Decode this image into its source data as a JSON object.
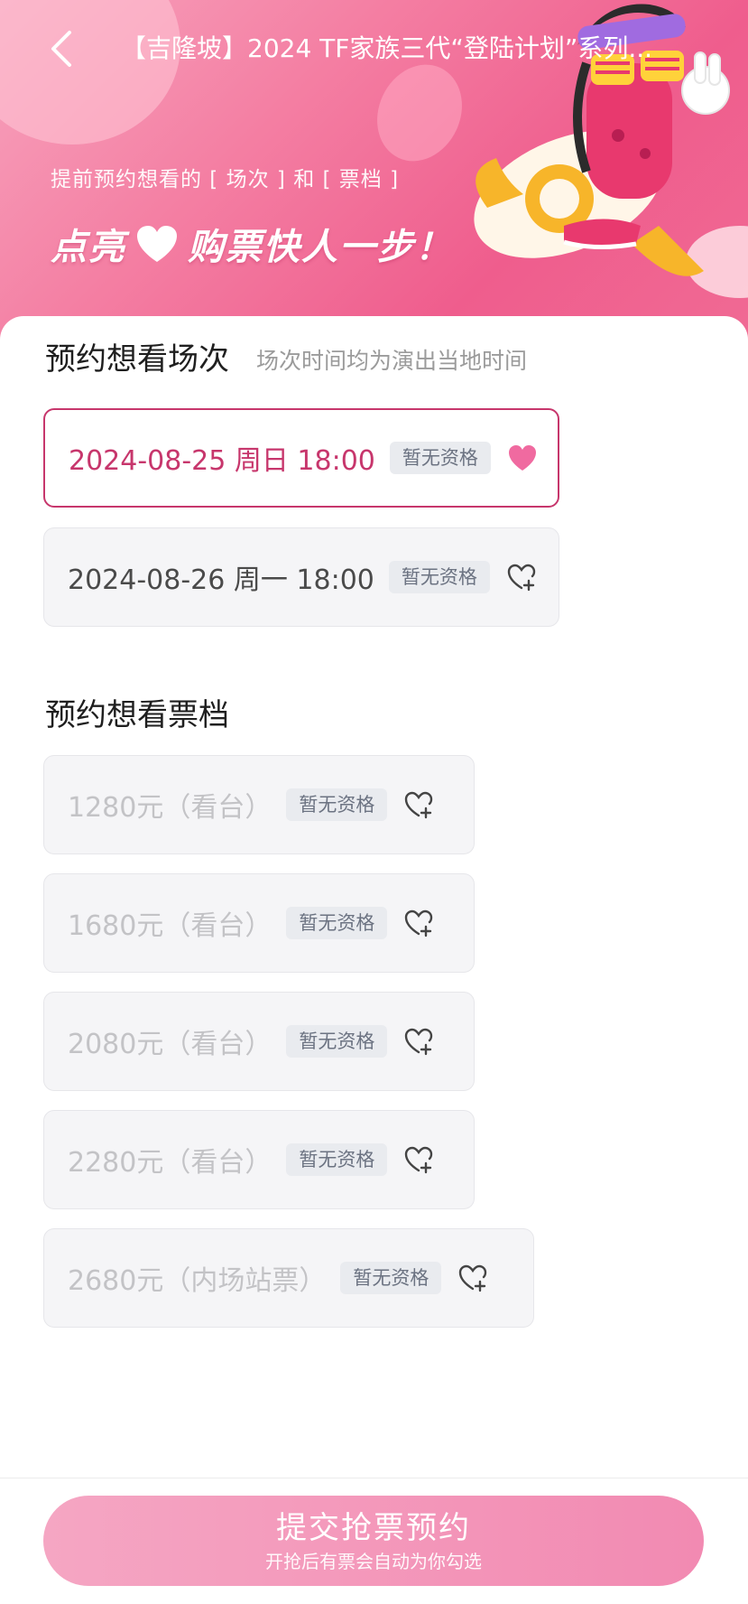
{
  "header": {
    "title": "【吉隆坡】2024 TF家族三代“登陆计划”系列...",
    "hint": "提前预约想看的 [ 场次 ] 和 [ 票档 ]",
    "slogan_left": "点亮",
    "slogan_right": "购票快人一步！"
  },
  "sessions": {
    "title": "预约想看场次",
    "subtitle": "场次时间均为演出当地时间",
    "items": [
      {
        "label": "2024-08-25 周日 18:00",
        "badge": "暂无资格",
        "selected": true
      },
      {
        "label": "2024-08-26 周一 18:00",
        "badge": "暂无资格",
        "selected": false
      }
    ]
  },
  "tiers": {
    "title": "预约想看票档",
    "items": [
      {
        "label": "1280元（看台）",
        "badge": "暂无资格"
      },
      {
        "label": "1680元（看台）",
        "badge": "暂无资格"
      },
      {
        "label": "2080元（看台）",
        "badge": "暂无资格"
      },
      {
        "label": "2280元（看台）",
        "badge": "暂无资格"
      },
      {
        "label": "2680元（内场站票）",
        "badge": "暂无资格"
      }
    ]
  },
  "footer": {
    "submit_label": "提交抢票预约",
    "submit_sub": "开抢后有票会自动为你勾选"
  },
  "colors": {
    "accent": "#c7366c",
    "banner": "#f47fa3",
    "button": "#f28ab2",
    "badge_bg": "#e9ebef"
  },
  "icons": [
    "back-arrow-icon",
    "heart-filled-icon",
    "heart-plus-icon"
  ]
}
